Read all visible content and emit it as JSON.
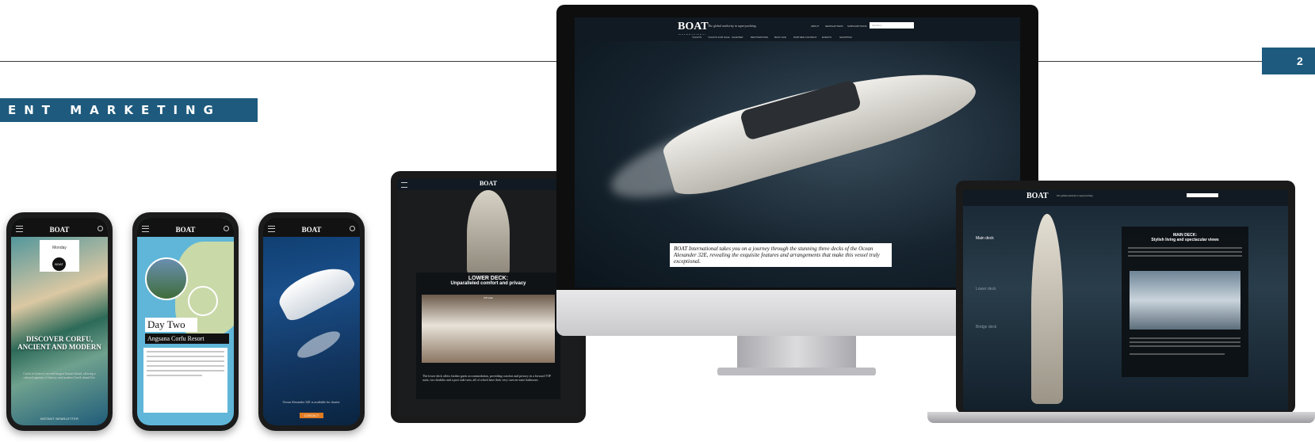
{
  "banner": {
    "text": "ENT MARKETING"
  },
  "page_number": "2",
  "imac": {
    "logo": "BOAT",
    "logo_sub": "INTERNATIONAL",
    "tagline": "The global authority in superyachting",
    "top_links": [
      "ABOUT",
      "NEWSLETTERS",
      "SUBSCRIPTIONS"
    ],
    "search_placeholder": "SEARCH",
    "nav_items": [
      "YACHTS",
      "YACHTS FOR SALE",
      "CHARTER",
      "DESTINATIONS",
      "BOAT LIFE",
      "PARTNER CONTENT",
      "EVENTS",
      "SHOPPING"
    ],
    "caption": "BOAT International takes you on a journey through the stunning three decks of the Ocean Alexander 32E, revealing the exquisite features and arrangements that make this vessel truly exceptional."
  },
  "laptop": {
    "logo": "BOAT",
    "tagline": "The global authority in superyachting",
    "deck_labels": [
      "Main deck",
      "Lower deck",
      "Bridge deck"
    ],
    "panel_title": "MAIN DECK:",
    "panel_subtitle": "Stylish living and spectacular views"
  },
  "tablet": {
    "logo": "BOAT",
    "panel_title": "LOWER DECK:",
    "panel_subtitle": "Unparalleled comfort and privacy",
    "photo_caption": "VIP suite",
    "body": "The lower deck offers further guest accommodation, providing comfort and privacy in a forward VIP suite, two doubles and a port side twin, all of which have their very own en-suite bathroom."
  },
  "phones": [
    {
      "logo": "BOAT",
      "pill": "Monday",
      "headline": "DISCOVER CORFU, ANCIENT AND MODERN",
      "sub": "Corfu is Greece's second-largest Ionian Island, offering a cultural tapestry of history and modern Greek island life.",
      "cta": "INSTANT NEWSLETTER"
    },
    {
      "logo": "BOAT",
      "day": "Day Two",
      "resort": "Angsana Corfu Resort"
    },
    {
      "logo": "BOAT",
      "caption": "Ocean Alexander 32E is available for charter.",
      "cta": "CONTACT"
    }
  ],
  "colors": {
    "accent": "#1e5a7d",
    "dark": "#0a1621",
    "orange": "#e07b22"
  }
}
